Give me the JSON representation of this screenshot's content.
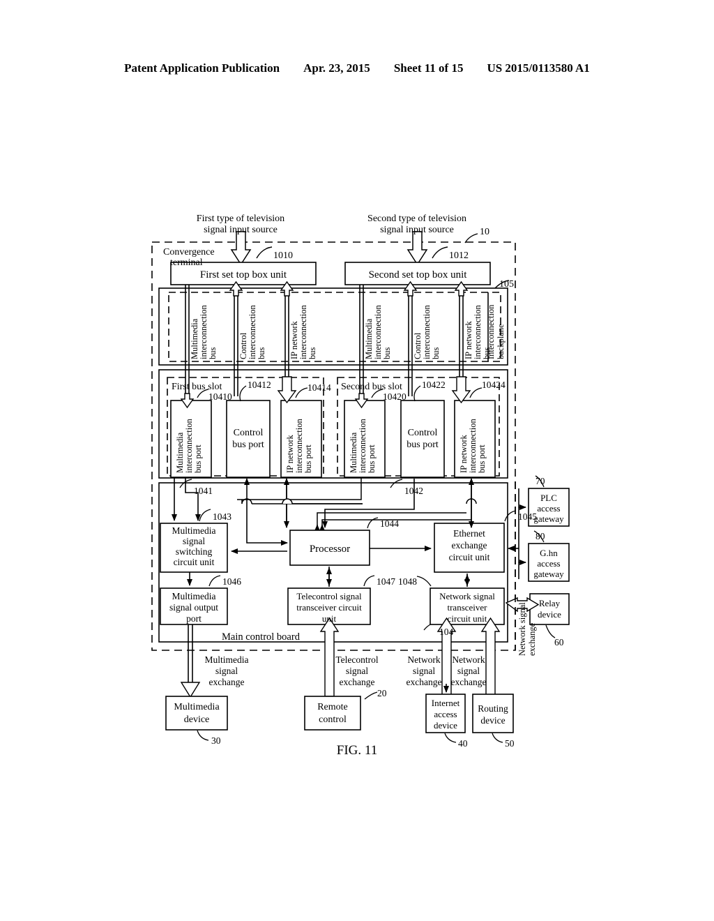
{
  "header": {
    "publication": "Patent Application Publication",
    "date": "Apr. 23, 2015",
    "sheet": "Sheet 11 of 15",
    "docnum": "US 2015/0113580 A1"
  },
  "figure": {
    "caption": "FIG. 11"
  },
  "inputs": {
    "first_source_l1": "First type of television",
    "first_source_l2": "signal input source",
    "second_source_l1": "Second type of television",
    "second_source_l2": "signal input source"
  },
  "terminal": {
    "label_l1": "Convergence",
    "label_l2": "terminal",
    "ref": "10"
  },
  "stb": {
    "first": {
      "label": "First set top box unit",
      "ref": "1010"
    },
    "second": {
      "label": "Second set top box unit",
      "ref": "1012"
    }
  },
  "backplane": {
    "ref": "105",
    "label_l1": "Interconnection",
    "label_l2": "backplane",
    "buses_left": [
      {
        "l1": "Multimedia",
        "l2": "interconnection",
        "l3": "bus"
      },
      {
        "l1": "Control",
        "l2": "interconnection",
        "l3": "bus"
      },
      {
        "l1": "IP network",
        "l2": "interconnection",
        "l3": "bus"
      }
    ],
    "buses_right": [
      {
        "l1": "Multimedia",
        "l2": "interconnection",
        "l3": "bus"
      },
      {
        "l1": "Control",
        "l2": "interconnection",
        "l3": "bus"
      },
      {
        "l1": "IP network",
        "l2": "interconnection",
        "l3": "bus"
      }
    ]
  },
  "slots": {
    "first": {
      "title": "First bus slot",
      "ports": [
        {
          "l1": "Multimedia",
          "l2": "interconnection",
          "l3": "bus port",
          "ref": "10410",
          "vertical": true
        },
        {
          "l1": "Control",
          "l2": "bus port",
          "ref": "10412",
          "vertical": false
        },
        {
          "l1": "IP network",
          "l2": "interconnection",
          "l3": "bus port",
          "ref": "10414",
          "vertical": true
        }
      ]
    },
    "second": {
      "title": "Second bus slot",
      "ports": [
        {
          "l1": "Multimedia",
          "l2": "interconnection",
          "l3": "bus port",
          "ref": "10420",
          "vertical": true
        },
        {
          "l1": "Control",
          "l2": "bus port",
          "ref": "10422",
          "vertical": false
        },
        {
          "l1": "IP network",
          "l2": "interconnection",
          "l3": "bus port",
          "ref": "10424",
          "vertical": true
        }
      ]
    }
  },
  "mainboard": {
    "label": "Main control board",
    "ref": "104",
    "units": {
      "mm_switch": {
        "l1": "Multimedia",
        "l2": "signal",
        "l3": "switching",
        "l4": "circuit unit",
        "ref": "1043"
      },
      "processor": {
        "l1": "Processor",
        "ref": "1044"
      },
      "ethernet": {
        "l1": "Ethernet",
        "l2": "exchange",
        "l3": "circuit unit",
        "ref": "1045"
      },
      "mm_out": {
        "l1": "Multimedia",
        "l2": "signal output",
        "l3": "port",
        "ref": "1046"
      },
      "telecontrol": {
        "l1": "Telecontrol signal",
        "l2": "transceiver circuit",
        "l3": "unit",
        "ref": "1047"
      },
      "net_xcvr": {
        "l1": "Network signal",
        "l2": "transceiver",
        "l3": "circuit unit",
        "ref": "1048"
      }
    },
    "link_refs": {
      "left": "1041",
      "right": "1042"
    }
  },
  "exchanges": {
    "multimedia": {
      "l1": "Multimedia",
      "l2": "signal",
      "l3": "exchange"
    },
    "telecontrol": {
      "l1": "Telecontrol",
      "l2": "signal",
      "l3": "exchange"
    },
    "network_a": {
      "l1": "Network",
      "l2": "signal",
      "l3": "exchange"
    },
    "network_b": {
      "l1": "Network",
      "l2": "signal",
      "l3": "exchange"
    },
    "network_side": {
      "l1": "Network signal",
      "l2": "exchange"
    }
  },
  "devices": {
    "multimedia": {
      "l1": "Multimedia",
      "l2": "device",
      "ref": "30"
    },
    "remote": {
      "l1": "Remote",
      "l2": "control",
      "ref": "20"
    },
    "internet": {
      "l1": "Internet",
      "l2": "access",
      "l3": "device",
      "ref": "40"
    },
    "routing": {
      "l1": "Routing",
      "l2": "device",
      "ref": "50"
    },
    "plc": {
      "l1": "PLC",
      "l2": "access",
      "l3": "gateway",
      "ref": "70"
    },
    "ghn": {
      "l1": "G.hn",
      "l2": "access",
      "l3": "gateway",
      "ref": "80"
    },
    "relay": {
      "l1": "Relay",
      "l2": "device",
      "ref": "60"
    }
  }
}
